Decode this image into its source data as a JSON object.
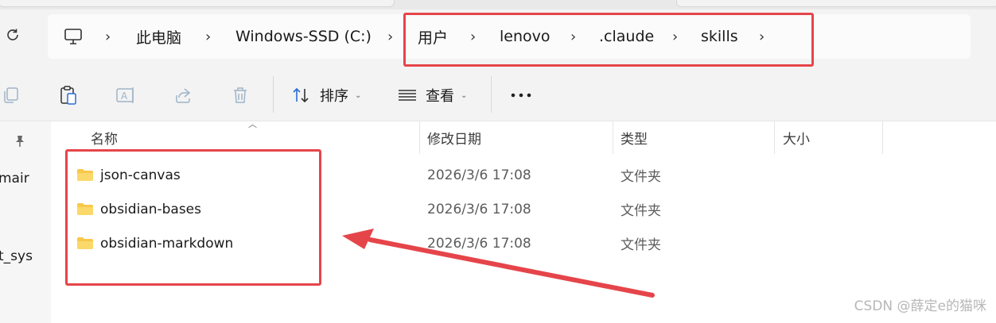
{
  "address": {
    "crumbs": [
      "此电脑",
      "Windows-SSD (C:)",
      "用户",
      "lenovo",
      ".claude",
      "skills"
    ]
  },
  "toolbar": {
    "sort_label": "排序",
    "view_label": "查看"
  },
  "nav": {
    "items": [
      "mair",
      "t_sys"
    ]
  },
  "columns": {
    "name": "名称",
    "modified": "修改日期",
    "type": "类型",
    "size": "大小"
  },
  "files": [
    {
      "name": "json-canvas",
      "modified": "2026/3/6 17:08",
      "type": "文件夹",
      "size": ""
    },
    {
      "name": "obsidian-bases",
      "modified": "2026/3/6 17:08",
      "type": "文件夹",
      "size": ""
    },
    {
      "name": "obsidian-markdown",
      "modified": "2026/3/6 17:08",
      "type": "文件夹",
      "size": ""
    }
  ],
  "watermark": "CSDN @薛定e的猫咪",
  "colors": {
    "highlight": "#e5454a",
    "folder": "#f8c84a"
  }
}
